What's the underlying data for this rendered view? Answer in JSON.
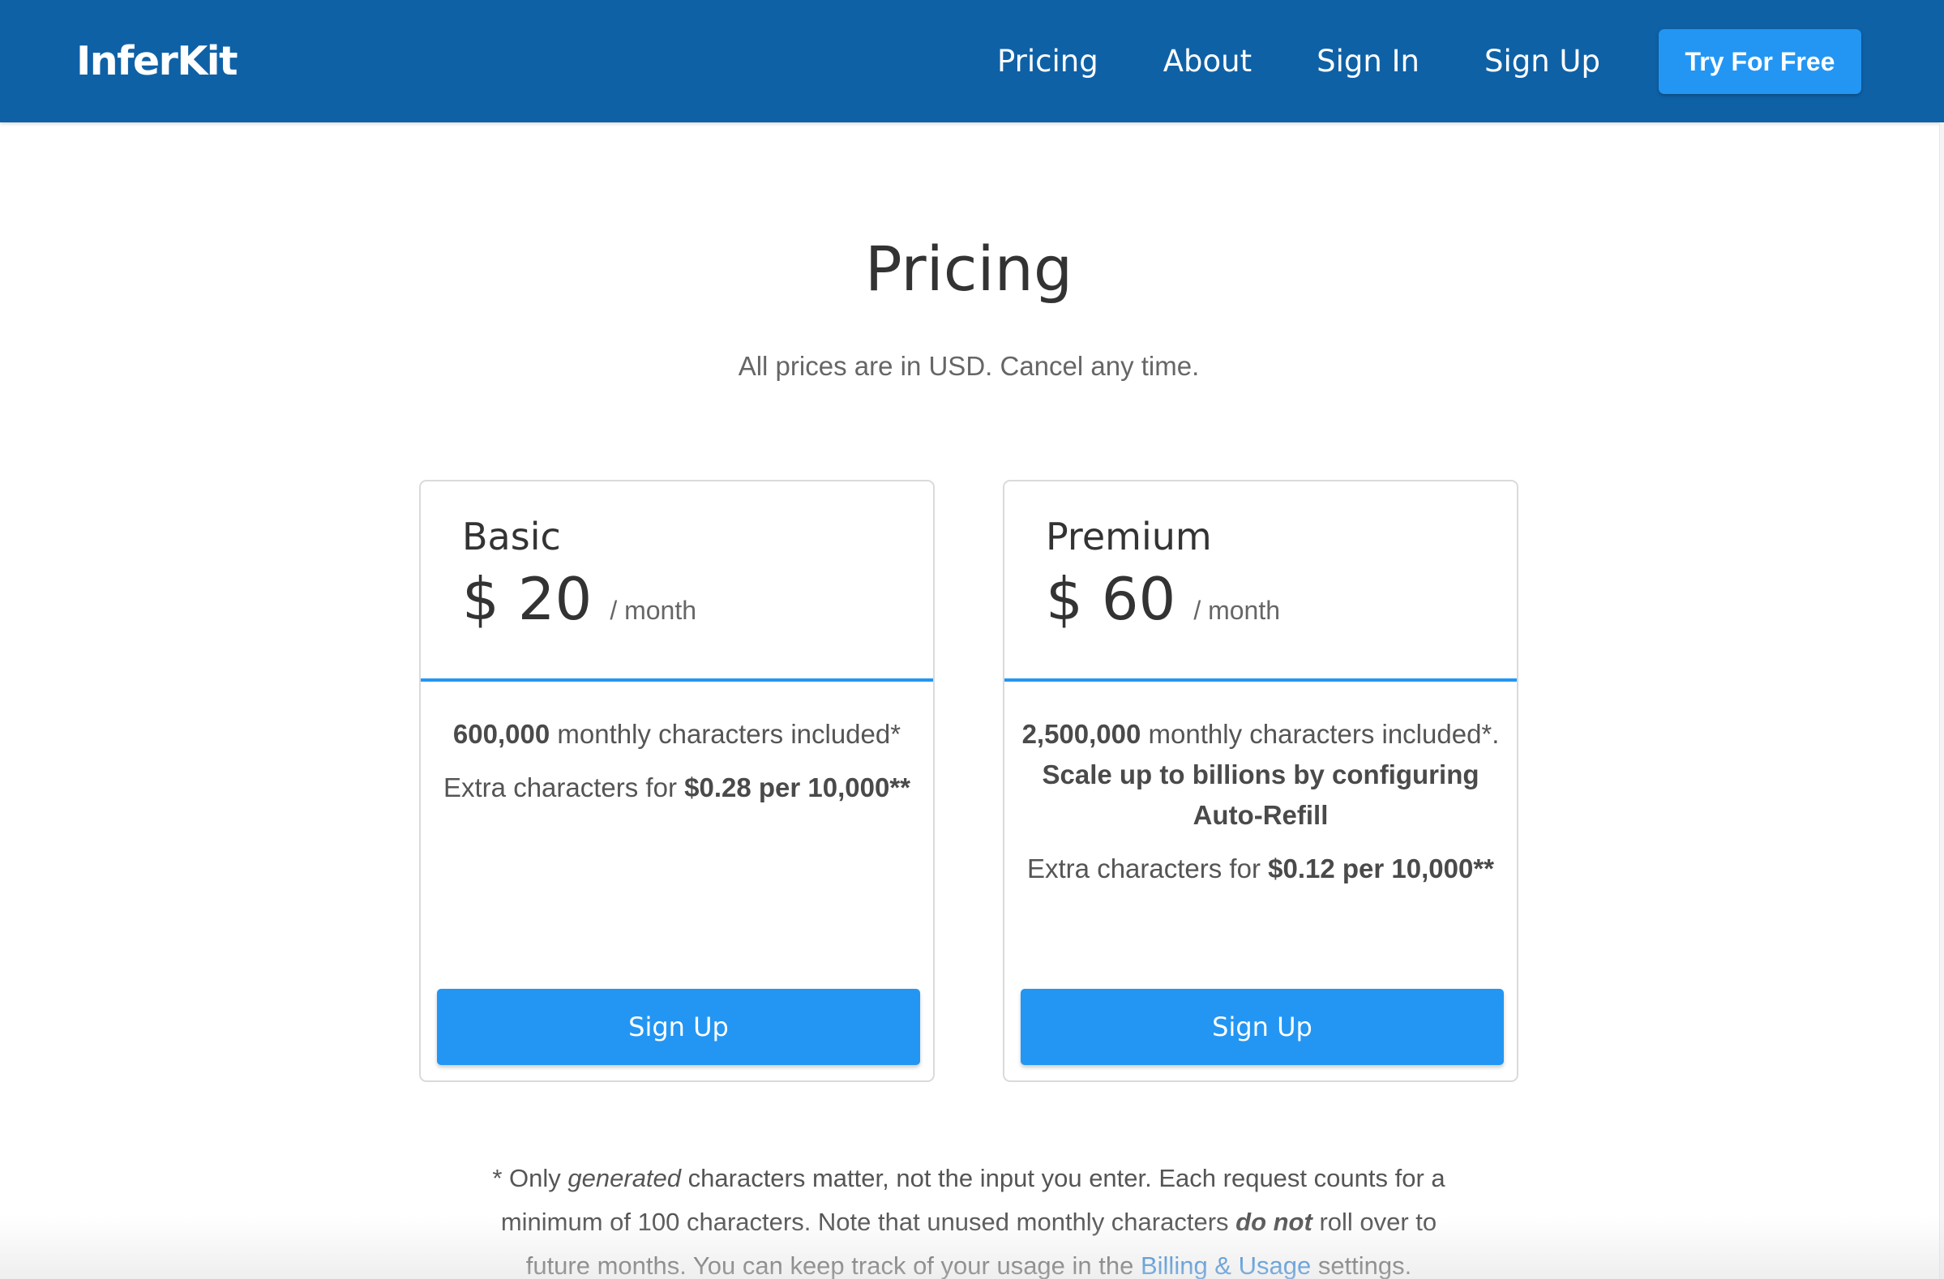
{
  "nav": {
    "brand": "InferKit",
    "links": [
      "Pricing",
      "About",
      "Sign In",
      "Sign Up"
    ],
    "cta": "Try For Free"
  },
  "header": {
    "title": "Pricing",
    "subtitle": "All prices are in USD. Cancel any time."
  },
  "plans": [
    {
      "name": "Basic",
      "price": "$ 20",
      "period": "/ month",
      "chars_bold": "600,000",
      "chars_text": " monthly characters included*",
      "scale_text": "",
      "extra_prefix": "Extra characters for ",
      "extra_bold": "$0.28 per 10,000**",
      "button": "Sign Up"
    },
    {
      "name": "Premium",
      "price": "$ 60",
      "period": "/ month",
      "chars_bold": "2,500,000",
      "chars_text": " monthly characters included*. ",
      "scale_text": "Scale up to billions by configuring Auto-Refill",
      "extra_prefix": "Extra characters for ",
      "extra_bold": "$0.12 per 10,000**",
      "button": "Sign Up"
    }
  ],
  "footnote": {
    "prefix": "* Only ",
    "generated": "generated",
    "mid": " characters matter, not the input you enter. Each request counts for a minimum of 100 characters. Note that unused monthly characters ",
    "do_not": "do not",
    "after": " roll over to future months. You can keep track of your usage in the ",
    "link": "Billing & Usage",
    "end": " settings."
  },
  "colors": {
    "navbar": "#0f61a6",
    "accent": "#2396f3",
    "link": "#1a7ad6"
  }
}
